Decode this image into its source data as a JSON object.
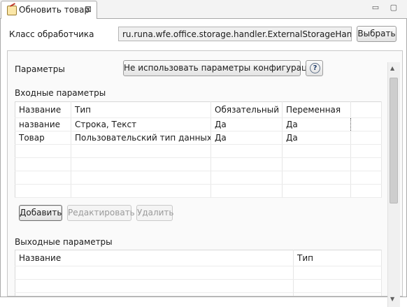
{
  "tab": {
    "title": "Обновить товар",
    "close_glyph": "⊠"
  },
  "window_buttons": "▭ ▢",
  "handler": {
    "label": "Класс обработчика",
    "value": "ru.runa.wfe.office.storage.handler.ExternalStorageHandler",
    "select_label": "Выбрать"
  },
  "params": {
    "label": "Параметры",
    "config_button": "Не использовать параметры конфигурации",
    "help_glyph": "?"
  },
  "input_params": {
    "title": "Входные параметры",
    "columns": [
      "Название",
      "Тип",
      "Обязательный",
      "Переменная"
    ],
    "rows": [
      [
        "название",
        "Строка, Текст",
        "Да",
        "Да"
      ],
      [
        "Товар",
        "Пользовательский тип данных",
        "Да",
        "Да"
      ]
    ],
    "buttons": {
      "add": "Добавить",
      "edit": "Редактировать",
      "delete": "Удалить"
    }
  },
  "output_params": {
    "title": "Выходные параметры",
    "columns": [
      "Название",
      "Тип"
    ]
  },
  "icons": {
    "tab": "edit-document-icon",
    "help": "help-icon",
    "up": "arrow-up-icon",
    "down": "arrow-down-icon"
  }
}
